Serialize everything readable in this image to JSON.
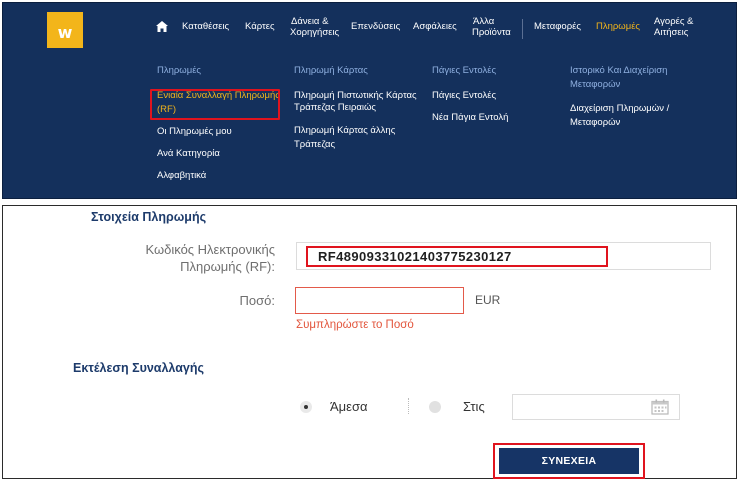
{
  "logo": {
    "letter": "w"
  },
  "nav": {
    "items": [
      {
        "label": "Καταθέσεις"
      },
      {
        "label": "Κάρτες"
      },
      {
        "label_line1": "Δάνεια &",
        "label_line2": "Χορηγήσεις"
      },
      {
        "label": "Επενδύσεις"
      },
      {
        "label": "Ασφάλειες"
      },
      {
        "label_line1": "Άλλα",
        "label_line2": "Προϊόντα"
      },
      {
        "label": "Μεταφορές"
      },
      {
        "label": "Πληρωμές"
      },
      {
        "label_line1": "Αγορές &",
        "label_line2": "Αιτήσεις"
      }
    ]
  },
  "menu": {
    "col1": {
      "title": "Πληρωμές",
      "links": [
        {
          "line1": "Ενιαία Συναλλαγή Πληρωμής",
          "line2": "(RF)"
        },
        {
          "line1": "Οι Πληρωμές μου"
        },
        {
          "line1": "Ανά Κατηγορία"
        },
        {
          "line1": "Αλφαβητικά"
        }
      ]
    },
    "col2": {
      "title": "Πληρωμή Κάρτας",
      "links": [
        {
          "line1": "Πληρωμή Πιστωτικής Κάρτας",
          "line2": "Τράπεζας Πειραιώς"
        },
        {
          "line1": "Πληρωμή Κάρτας άλλης",
          "line2": "Τράπεζας"
        }
      ]
    },
    "col3": {
      "title": "Πάγιες Εντολές",
      "links": [
        {
          "line1": "Πάγιες Εντολές"
        },
        {
          "line1": "Νέα Πάγια Εντολή"
        }
      ]
    },
    "col4": {
      "title_line1": "Ιστορικό Και Διαχείριση",
      "title_line2": "Μεταφορών",
      "links": [
        {
          "line1": "Διαχείριση Πληρωμών /",
          "line2": "Μεταφορών"
        }
      ]
    }
  },
  "form": {
    "section_payment": "Στοιχεία Πληρωμής",
    "rf_label_line1": "Κωδικός Ηλεκτρονικής",
    "rf_label_line2": "Πληρωμής (RF):",
    "rf_value": "RF48909331021403775230127",
    "amount_label": "Ποσό:",
    "amount_value": "",
    "currency": "EUR",
    "amount_error": "Συμπληρώστε το Ποσό",
    "section_execution": "Εκτέλεση Συναλλαγής",
    "option_now": "Άμεσα",
    "option_on": "Στις",
    "date_value": "",
    "continue_label": "ΣΥΝΕΧΕΙΑ"
  },
  "colors": {
    "nav_bg": "#14305c",
    "accent": "#f3b51a",
    "highlight": "#e0141e",
    "error": "#e2553c",
    "button_bg": "#163466"
  }
}
